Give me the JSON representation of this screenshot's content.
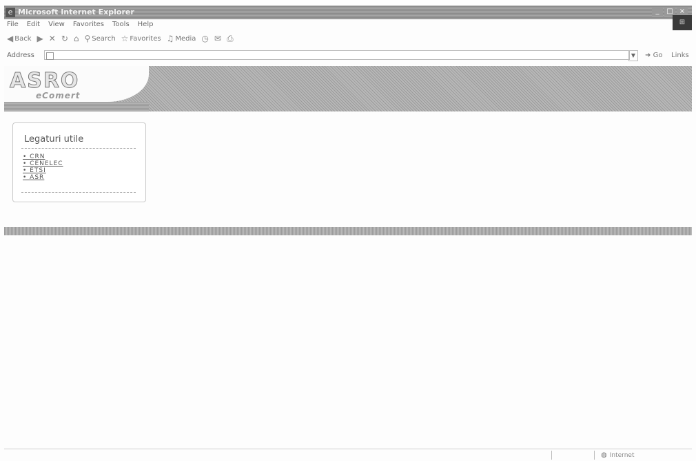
{
  "window": {
    "title": "Microsoft Internet Explorer"
  },
  "menubar": {
    "items": [
      "File",
      "Edit",
      "View",
      "Favorites",
      "Tools",
      "Help"
    ]
  },
  "toolbar": {
    "back": "Back",
    "search": "Search",
    "favorites": "Favorites",
    "media": "Media"
  },
  "addressbar": {
    "label": "Address",
    "go": "Go",
    "links": "Links"
  },
  "sidebar": {
    "title": "Legaturi utile",
    "links": [
      "CRN",
      "CENELEC",
      "ETSI",
      "ASR"
    ]
  },
  "statusbar": {
    "zone": "Internet"
  },
  "icons": {
    "browser": "ie-icon",
    "back": "back-arrow-icon",
    "forward": "forward-arrow-icon",
    "stop": "stop-icon",
    "refresh": "refresh-icon",
    "home": "home-icon",
    "search": "search-icon",
    "favorites": "star-icon",
    "media": "media-icon",
    "history": "history-icon",
    "mail": "mail-icon",
    "print": "print-icon",
    "go": "go-arrow-icon",
    "zone": "globe-icon"
  }
}
